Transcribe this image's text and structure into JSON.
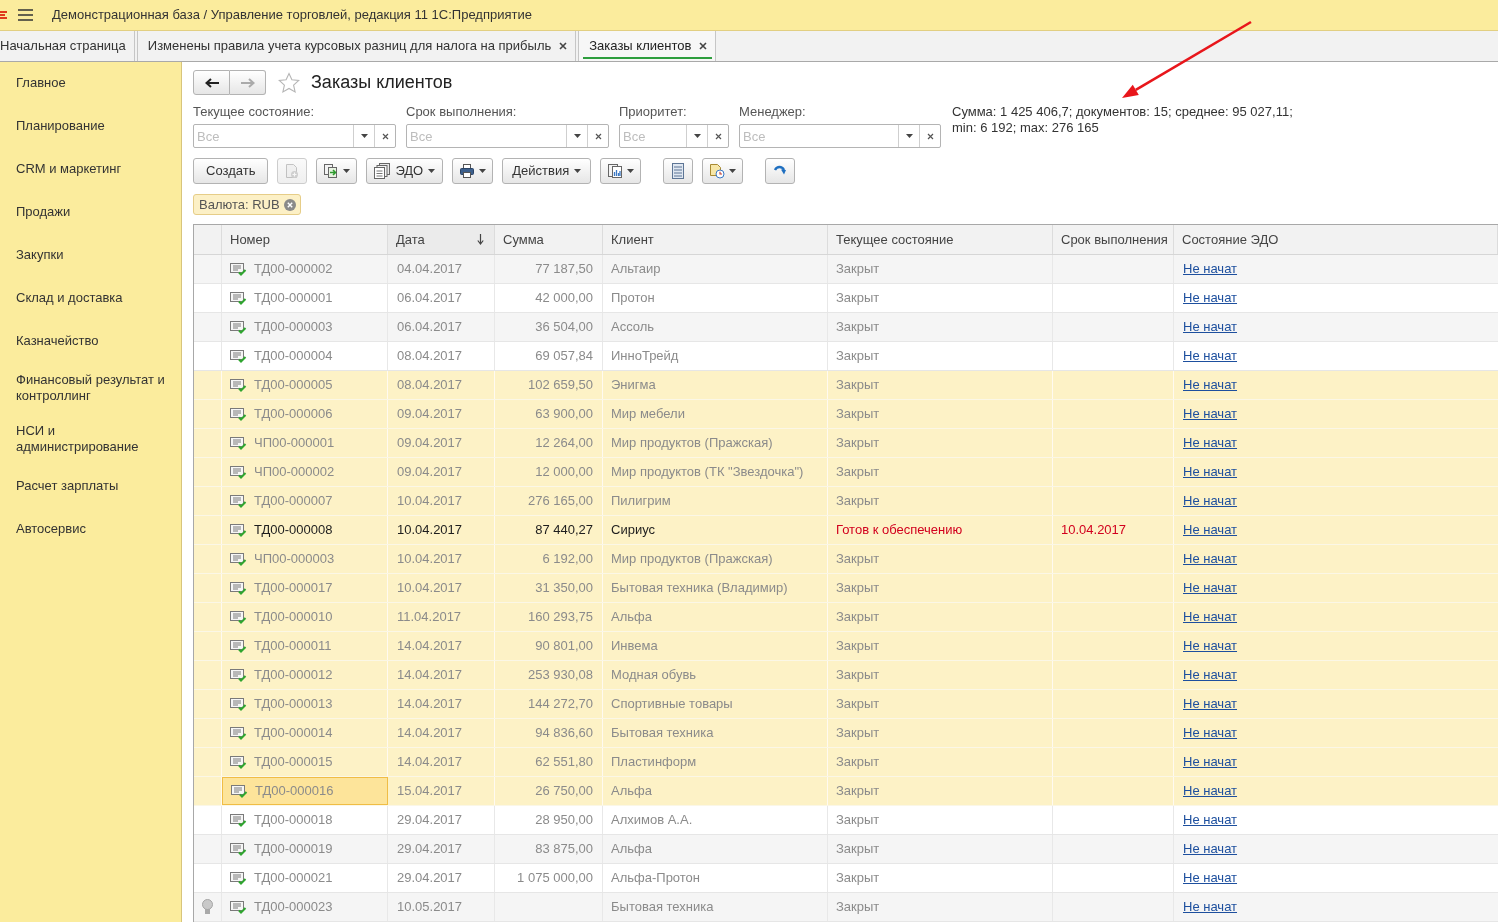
{
  "window": {
    "title": "Демонстрационная база / Управление торговлей, редакция 11 1С:Предприятие"
  },
  "tabs": [
    {
      "label": "Начальная страница",
      "selected": false,
      "closable": false
    },
    {
      "label": "Изменены правила учета курсовых разниц для налога на прибыль",
      "selected": false,
      "closable": true
    },
    {
      "label": "Заказы клиентов",
      "selected": true,
      "closable": true
    }
  ],
  "sidebar": {
    "items": [
      "Главное",
      "Планирование",
      "CRM и маркетинг",
      "Продажи",
      "Закупки",
      "Склад и доставка",
      "Казначейство",
      "Финансовый результат и контроллинг",
      "НСИ и администрирование",
      "Расчет зарплаты",
      "Автосервис"
    ]
  },
  "page": {
    "title": "Заказы клиентов",
    "favorite": false,
    "navigation": {
      "back": {
        "disabled": false
      },
      "forward": {
        "disabled": true
      }
    }
  },
  "filters": [
    {
      "label": "Текущее состояние:",
      "placeholder": "Все"
    },
    {
      "label": "Срок выполнения:",
      "placeholder": "Все"
    },
    {
      "label": "Приоритет:",
      "placeholder": "Все"
    },
    {
      "label": "Менеджер:",
      "placeholder": "Все"
    }
  ],
  "summary": {
    "lines": [
      "Сумма: 1 425 406,7; документов: 15; среднее: 95 027,11;",
      "min: 6 192; max: 276 165"
    ]
  },
  "toolbar": {
    "groups": [
      {
        "buttons": [
          {
            "label": "Создать",
            "dropdown": false,
            "disabled": false
          },
          {
            "dropdown": false,
            "disabled": true
          },
          {
            "dropdown": true,
            "disabled": false
          },
          {
            "label": "ЭДО",
            "dropdown": true,
            "disabled": false
          },
          {
            "dropdown": true,
            "disabled": false
          },
          {
            "label": "Действия",
            "dropdown": true,
            "disabled": false
          },
          {
            "dropdown": true,
            "disabled": false
          }
        ]
      },
      {
        "buttons": [
          {
            "dropdown": false,
            "disabled": false
          },
          {
            "dropdown": true,
            "disabled": false
          }
        ]
      },
      {
        "buttons": [
          {
            "dropdown": false,
            "disabled": false
          }
        ]
      }
    ]
  },
  "filter_tags": [
    {
      "text": "Валюта: RUB"
    }
  ],
  "table": {
    "columns": [
      {
        "label": "Номер",
        "sorted": false
      },
      {
        "label": "Дата",
        "sorted": true
      },
      {
        "label": "Сумма",
        "sorted": false
      },
      {
        "label": "Клиент",
        "sorted": false
      },
      {
        "label": "Текущее состояние",
        "sorted": false
      },
      {
        "label": "Срок выполнения",
        "sorted": false
      },
      {
        "label": "Состояние ЭДО",
        "sorted": false
      }
    ],
    "rows": [
      {
        "number": "ТД00-000002",
        "date": "04.04.2017",
        "sum": "77 187,50",
        "client": "Альтаир",
        "state": "Закрыт",
        "edo": "Не начат",
        "kind": "closed",
        "selected": false,
        "current": false,
        "bulb": false
      },
      {
        "number": "ТД00-000001",
        "date": "06.04.2017",
        "sum": "42 000,00",
        "client": "Протон",
        "state": "Закрыт",
        "edo": "Не начат",
        "kind": "closed",
        "selected": false,
        "current": false,
        "bulb": false
      },
      {
        "number": "ТД00-000003",
        "date": "06.04.2017",
        "sum": "36 504,00",
        "client": "Ассоль",
        "state": "Закрыт",
        "edo": "Не начат",
        "kind": "closed",
        "selected": false,
        "current": false,
        "bulb": false
      },
      {
        "number": "ТД00-000004",
        "date": "08.04.2017",
        "sum": "69 057,84",
        "client": "ИнноТрейд",
        "state": "Закрыт",
        "edo": "Не начат",
        "kind": "closed",
        "selected": false,
        "current": false,
        "bulb": false
      },
      {
        "number": "ТД00-000005",
        "date": "08.04.2017",
        "sum": "102 659,50",
        "client": "Энигма",
        "state": "Закрыт",
        "edo": "Не начат",
        "kind": "closed",
        "selected": true,
        "current": false,
        "bulb": false
      },
      {
        "number": "ТД00-000006",
        "date": "09.04.2017",
        "sum": "63 900,00",
        "client": "Мир мебели",
        "state": "Закрыт",
        "edo": "Не начат",
        "kind": "closed",
        "selected": true,
        "current": false,
        "bulb": false
      },
      {
        "number": "ЧП00-000001",
        "date": "09.04.2017",
        "sum": "12 264,00",
        "client": "Мир продуктов (Пражская)",
        "state": "Закрыт",
        "edo": "Не начат",
        "kind": "closed",
        "selected": true,
        "current": false,
        "bulb": false
      },
      {
        "number": "ЧП00-000002",
        "date": "09.04.2017",
        "sum": "12 000,00",
        "client": "Мир продуктов (ТК \"Звездочка\")",
        "state": "Закрыт",
        "edo": "Не начат",
        "kind": "closed",
        "selected": true,
        "current": false,
        "bulb": false
      },
      {
        "number": "ТД00-000007",
        "date": "10.04.2017",
        "sum": "276 165,00",
        "client": "Пилигрим",
        "state": "Закрыт",
        "edo": "Не начат",
        "kind": "closed",
        "selected": true,
        "current": false,
        "bulb": false
      },
      {
        "number": "ТД00-000008",
        "date": "10.04.2017",
        "sum": "87 440,27",
        "client": "Сириус",
        "state": "Готов к обеспечению",
        "deadline": "10.04.2017",
        "edo": "Не начат",
        "kind": "ready",
        "selected": true,
        "current": false,
        "bulb": false
      },
      {
        "number": "ЧП00-000003",
        "date": "10.04.2017",
        "sum": "6 192,00",
        "client": "Мир продуктов (Пражская)",
        "state": "Закрыт",
        "edo": "Не начат",
        "kind": "closed",
        "selected": true,
        "current": false,
        "bulb": false
      },
      {
        "number": "ТД00-000017",
        "date": "10.04.2017",
        "sum": "31 350,00",
        "client": "Бытовая техника (Владимир)",
        "state": "Закрыт",
        "edo": "Не начат",
        "kind": "closed",
        "selected": true,
        "current": false,
        "bulb": false
      },
      {
        "number": "ТД00-000010",
        "date": "11.04.2017",
        "sum": "160 293,75",
        "client": "Альфа",
        "state": "Закрыт",
        "edo": "Не начат",
        "kind": "closed",
        "selected": true,
        "current": false,
        "bulb": false
      },
      {
        "number": "ТД00-000011",
        "date": "14.04.2017",
        "sum": "90 801,00",
        "client": "Инвема",
        "state": "Закрыт",
        "edo": "Не начат",
        "kind": "closed",
        "selected": true,
        "current": false,
        "bulb": false
      },
      {
        "number": "ТД00-000012",
        "date": "14.04.2017",
        "sum": "253 930,08",
        "client": "Модная обувь",
        "state": "Закрыт",
        "edo": "Не начат",
        "kind": "closed",
        "selected": true,
        "current": false,
        "bulb": false
      },
      {
        "number": "ТД00-000013",
        "date": "14.04.2017",
        "sum": "144 272,70",
        "client": "Спортивные товары",
        "state": "Закрыт",
        "edo": "Не начат",
        "kind": "closed",
        "selected": true,
        "current": false,
        "bulb": false
      },
      {
        "number": "ТД00-000014",
        "date": "14.04.2017",
        "sum": "94 836,60",
        "client": "Бытовая техника",
        "state": "Закрыт",
        "edo": "Не начат",
        "kind": "closed",
        "selected": true,
        "current": false,
        "bulb": false
      },
      {
        "number": "ТД00-000015",
        "date": "14.04.2017",
        "sum": "62 551,80",
        "client": "Пластинформ",
        "state": "Закрыт",
        "edo": "Не начат",
        "kind": "closed",
        "selected": true,
        "current": false,
        "bulb": false
      },
      {
        "number": "ТД00-000016",
        "date": "15.04.2017",
        "sum": "26 750,00",
        "client": "Альфа",
        "state": "Закрыт",
        "edo": "Не начат",
        "kind": "closed",
        "selected": true,
        "current": true,
        "bulb": false
      },
      {
        "number": "ТД00-000018",
        "date": "29.04.2017",
        "sum": "28 950,00",
        "client": "Алхимов А.А.",
        "state": "Закрыт",
        "edo": "Не начат",
        "kind": "closed",
        "selected": false,
        "current": false,
        "bulb": false
      },
      {
        "number": "ТД00-000019",
        "date": "29.04.2017",
        "sum": "83 875,00",
        "client": "Альфа",
        "state": "Закрыт",
        "edo": "Не начат",
        "kind": "closed",
        "selected": false,
        "current": false,
        "bulb": false
      },
      {
        "number": "ТД00-000021",
        "date": "29.04.2017",
        "sum": "1 075 000,00",
        "client": "Альфа-Протон",
        "state": "Закрыт",
        "edo": "Не начат",
        "kind": "closed",
        "selected": false,
        "current": false,
        "bulb": false
      },
      {
        "number": "ТД00-000023",
        "date": "10.05.2017",
        "client": "Бытовая техника",
        "state": "Закрыт",
        "edo": "Не начат",
        "kind": "closed",
        "selected": false,
        "current": false,
        "bulb": true
      }
    ]
  }
}
